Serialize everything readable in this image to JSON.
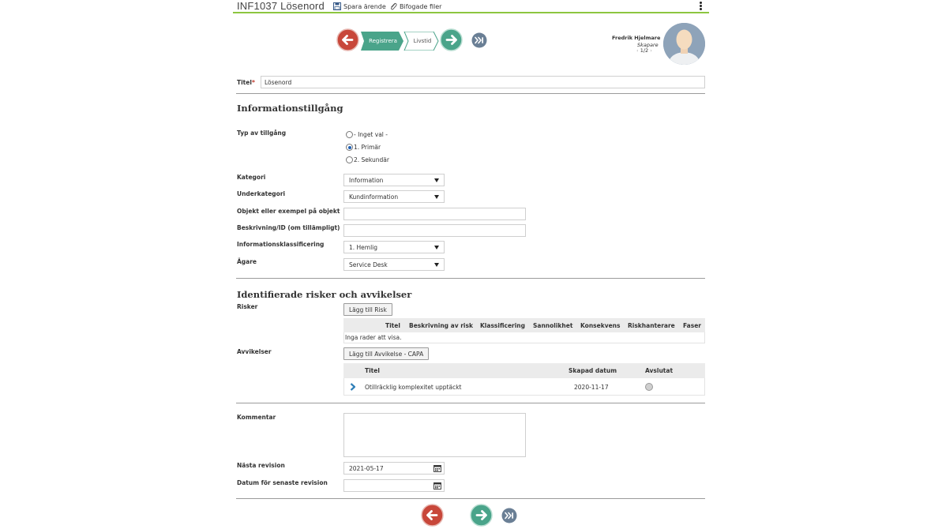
{
  "header": {
    "title": "INF1037 Lösenord",
    "save_label": "Spara ärende",
    "attachments_label": "Bifogade filer"
  },
  "workflow": {
    "steps": [
      "Registrera",
      "Livstid"
    ],
    "active_step_color": "#4aa48a"
  },
  "user": {
    "name": "Fredrik Hjelmare",
    "role": "Skapare",
    "pager": "1/2"
  },
  "form": {
    "title_label": "Titel",
    "title_required_mark": "*",
    "title_value": "Lösenord",
    "section_info": "Informationstillgång",
    "type_label": "Typ av tillgång",
    "type_options": [
      "- Inget val -",
      "1. Primär",
      "2. Sekundär"
    ],
    "type_selected": "1. Primär",
    "category_label": "Kategori",
    "category_value": "Information",
    "subcategory_label": "Underkategori",
    "subcategory_value": "Kundinformation",
    "object_label": "Objekt eller exempel på objekt",
    "object_value": "",
    "description_label": "Beskrivning/ID (om tillämpligt)",
    "description_value": "",
    "classification_label": "Informationsklassificering",
    "classification_value": "1. Hemlig",
    "owner_label": "Ägare",
    "owner_value": "Service Desk",
    "section_risks": "Identifierade risker och avvikelser",
    "risks_label": "Risker",
    "add_risk_label": "Lägg till Risk",
    "risk_columns": [
      "Titel",
      "Beskrivning av risk",
      "Klassificering",
      "Sannolikhet",
      "Konsekvens",
      "Riskhanterare",
      "Faser"
    ],
    "risk_empty": "Inga rader att visa.",
    "deviations_label": "Avvikelser",
    "add_deviation_label": "Lägg till Avvikelse - CAPA",
    "deviation_columns": [
      "Titel",
      "Skapad datum",
      "Avslutat"
    ],
    "deviation_rows": [
      {
        "title": "Otillräcklig komplexitet upptäckt",
        "created": "2020-11-17"
      }
    ],
    "comment_label": "Kommentar",
    "comment_value": "",
    "next_revision_label": "Nästa revision",
    "next_revision_value": "2021-05-17",
    "last_revision_label": "Datum för senaste revision",
    "last_revision_value": ""
  },
  "colors": {
    "back": "#c8473a",
    "forward": "#4aa48a",
    "skip": "#6a7f95",
    "accent_line": "#8dc63f"
  }
}
